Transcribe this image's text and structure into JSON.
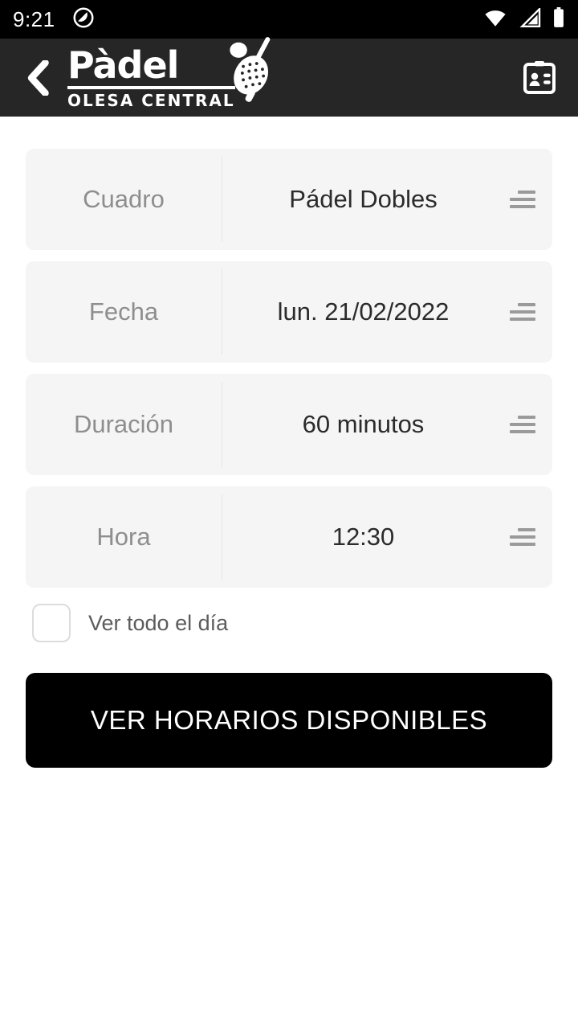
{
  "status_bar": {
    "time": "9:21",
    "icons": [
      "dnd-mode-icon",
      "wifi-icon",
      "cellular-signal-icon",
      "battery-icon"
    ]
  },
  "header": {
    "back_icon": "chevron-left-icon",
    "logo_main": "Pàdel",
    "logo_sub": "OLESA CENTRAL",
    "logo_mark": "padel-racket-icon",
    "action_icon": "id-badge-icon",
    "background_color": "#262626"
  },
  "form": {
    "rows": [
      {
        "label": "Cuadro",
        "value": "Pádel Dobles",
        "icon": "list-selector-icon"
      },
      {
        "label": "Fecha",
        "value": "lun. 21/02/2022",
        "icon": "list-selector-icon"
      },
      {
        "label": "Duración",
        "value": "60 minutos",
        "icon": "list-selector-icon"
      },
      {
        "label": "Hora",
        "value": "12:30",
        "icon": "list-selector-icon"
      }
    ],
    "checkbox": {
      "label": "Ver todo el día",
      "checked": false
    }
  },
  "cta": {
    "label": "VER HORARIOS DISPONIBLES",
    "background_color": "#000000",
    "text_color": "#ffffff"
  },
  "theme": {
    "page_background": "#ffffff",
    "card_background": "#f5f5f5",
    "label_color": "#8e8e8e",
    "value_color": "#2b2b2b",
    "divider_color": "#e6e6e6"
  }
}
